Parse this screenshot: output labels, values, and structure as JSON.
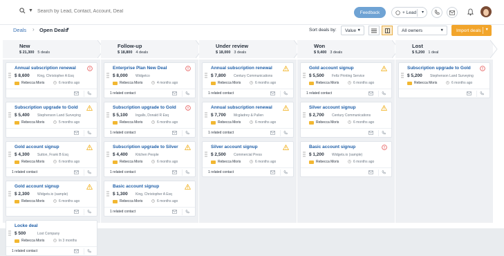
{
  "search": {
    "placeholder": "Search by Lead, Contact, Account, Deal"
  },
  "header": {
    "feedback_label": "Feedback",
    "lead_label": "+ Lead"
  },
  "breadcrumb": {
    "deals": "Deals",
    "separator": "›",
    "view": "Open Deals"
  },
  "toolbar": {
    "sort_label": "Sort deals by:",
    "sort_value": "Value",
    "owner_value": "All owners",
    "import_label": "Import deals"
  },
  "colors": {
    "accent": "#f2a52b",
    "link": "#1f5fa8",
    "warning": "#f2b731",
    "danger": "#e55353",
    "feedback": "#6fa3d4"
  },
  "stages": [
    {
      "name": "New",
      "amount": "$ 21,300",
      "count": "5 deals"
    },
    {
      "name": "Follow-up",
      "amount": "$ 18,800",
      "count": "4 deals"
    },
    {
      "name": "Under review",
      "amount": "$ 18,000",
      "count": "3 deals"
    },
    {
      "name": "Won",
      "amount": "$ 9,400",
      "count": "3 deals"
    },
    {
      "name": "Lost",
      "amount": "$ 5,200",
      "count": "1 deal"
    }
  ],
  "columns": [
    [
      {
        "title": "Annual subscription renewal",
        "amount": "$ 8,600",
        "org": "King, Christopher A Esq",
        "owner": "Rebecca Moris",
        "ago": "6 months ago",
        "status": "danger",
        "related": ""
      },
      {
        "title": "Subscription upgrade to Gold",
        "amount": "$ 5,400",
        "org": "Stephenson Land Surveying",
        "owner": "Rebecca Moris",
        "ago": "5 months ago",
        "status": "warning",
        "related": ""
      },
      {
        "title": "Gold account signup",
        "amount": "$ 4,300",
        "org": "Sutton, Frank B Esq",
        "owner": "Rebecca Moris",
        "ago": "6 months ago",
        "status": "warning",
        "related": "1 related contact"
      },
      {
        "title": "Gold account signup",
        "amount": "$ 2,300",
        "org": "Widgets.io (sample)",
        "owner": "Rebecca Moris",
        "ago": "6 months ago",
        "status": "warning",
        "related": ""
      },
      {
        "title": "Locke deal",
        "amount": "$ 500",
        "org": "Lost Company",
        "owner": "Rebecca Moris",
        "ago": "In 3 months",
        "status": "",
        "related": "1 related contact"
      }
    ],
    [
      {
        "title": "Enterprise Plan New Deal",
        "amount": "$ 8,000",
        "org": "Widgetco",
        "owner": "Rebecca Moris",
        "ago": "4 months ago",
        "status": "danger",
        "related": "1 related contact"
      },
      {
        "title": "Subscription upgrade to Gold",
        "amount": "$ 5,100",
        "org": "Ingalls, Donald R Esq",
        "owner": "Rebecca Moris",
        "ago": "6 months ago",
        "status": "danger",
        "related": "1 related contact"
      },
      {
        "title": "Subscription upgrade to Silver",
        "amount": "$ 4,400",
        "org": "Kitchen People",
        "owner": "Rebecca Moris",
        "ago": "6 months ago",
        "status": "warning",
        "related": "1 related contact"
      },
      {
        "title": "Basic account signup",
        "amount": "$ 1,300",
        "org": "King, Christopher A Esq",
        "owner": "Rebecca Moris",
        "ago": "6 months ago",
        "status": "warning",
        "related": "1 related contact"
      }
    ],
    [
      {
        "title": "Annual subscription renewal",
        "amount": "$ 7,800",
        "org": "Century Communications",
        "owner": "Rebecca Moris",
        "ago": "6 months ago",
        "status": "warning",
        "related": "1 related contact"
      },
      {
        "title": "Annual subscription renewal",
        "amount": "$ 7,700",
        "org": "Mcgladrey & Pullen",
        "owner": "Rebecca Moris",
        "ago": "6 months ago",
        "status": "warning",
        "related": "1 related contact"
      },
      {
        "title": "Silver account signup",
        "amount": "$ 2,500",
        "org": "Commercial Press",
        "owner": "Rebecca Moris",
        "ago": "6 months ago",
        "status": "warning",
        "related": "1 related contact"
      }
    ],
    [
      {
        "title": "Gold account signup",
        "amount": "$ 5,500",
        "org": "Feltz Printing Service",
        "owner": "Rebecca Moris",
        "ago": "6 months ago",
        "status": "warning",
        "related": "1 related contact"
      },
      {
        "title": "Silver account signup",
        "amount": "$ 2,700",
        "org": "Century Communications",
        "owner": "Rebecca Moris",
        "ago": "6 months ago",
        "status": "warning",
        "related": ""
      },
      {
        "title": "Basic account signup",
        "amount": "$ 1,200",
        "org": "Widgets.io (sample)",
        "owner": "Rebecca Moris",
        "ago": "6 months ago",
        "status": "danger",
        "related": ""
      }
    ],
    [
      {
        "title": "Subscription upgrade to Gold",
        "amount": "$ 5,200",
        "org": "Stephenson Land Surveying",
        "owner": "Rebecca Moris",
        "ago": "6 months ago",
        "status": "danger",
        "related": ""
      }
    ]
  ]
}
